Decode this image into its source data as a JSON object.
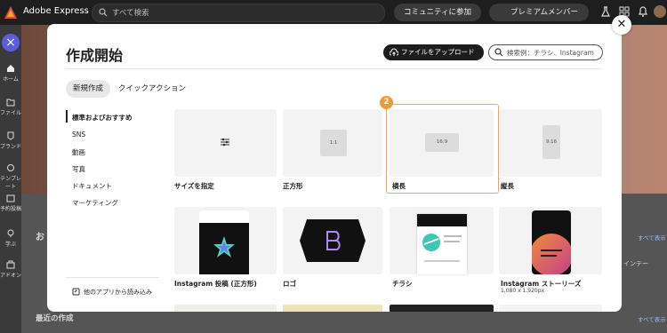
{
  "topbar": {
    "brand": "Adobe Express",
    "search_placeholder": "すべて検索",
    "community_label": "コミュニティに参加",
    "premium_label": "プレミアムメンバー"
  },
  "leftrail": {
    "items": [
      {
        "label": "ホーム",
        "icon": "home-icon"
      },
      {
        "label": "ファイル",
        "icon": "folder-icon"
      },
      {
        "label": "ブランド",
        "icon": "brand-icon"
      },
      {
        "label": "テンプレート",
        "icon": "template-icon"
      },
      {
        "label": "予約投稿",
        "icon": "calendar-icon"
      },
      {
        "label": "学ぶ",
        "icon": "learn-icon"
      },
      {
        "label": "アドオン",
        "icon": "addon-icon"
      }
    ]
  },
  "background": {
    "section_label": "お",
    "recent_label": "最近の作成",
    "see_all_1": "すべて表示",
    "see_all_2": "すべて表示",
    "partial_text": "インテー"
  },
  "modal": {
    "title": "作成開始",
    "upload_label": "ファイルをアップロード",
    "search_placeholder": "検索例：チラシ、Instagram",
    "tabs": [
      "新規作成",
      "クイックアクション"
    ],
    "nav": [
      "標準およびおすすめ",
      "SNS",
      "動画",
      "写真",
      "ドキュメント",
      "マーケティング"
    ],
    "other_apps": "他のアプリから読み込み",
    "badge": "2",
    "cards": [
      {
        "label": "サイズを指定"
      },
      {
        "label": "正方形",
        "ratio": "1:1"
      },
      {
        "label": "横長",
        "ratio": "16:9"
      },
      {
        "label": "縦長",
        "ratio": "9:16"
      },
      {
        "label": "Instagram 投稿 (正方形)"
      },
      {
        "label": "ロゴ"
      },
      {
        "label": "チラシ"
      },
      {
        "label": "Instagram ストーリーズ",
        "sub": "1,080 x 1,920px"
      }
    ]
  },
  "colors": {
    "accent_orange": "#f29a31",
    "fab": "#5c5ce0",
    "upload_bg": "#1d1d1d"
  }
}
